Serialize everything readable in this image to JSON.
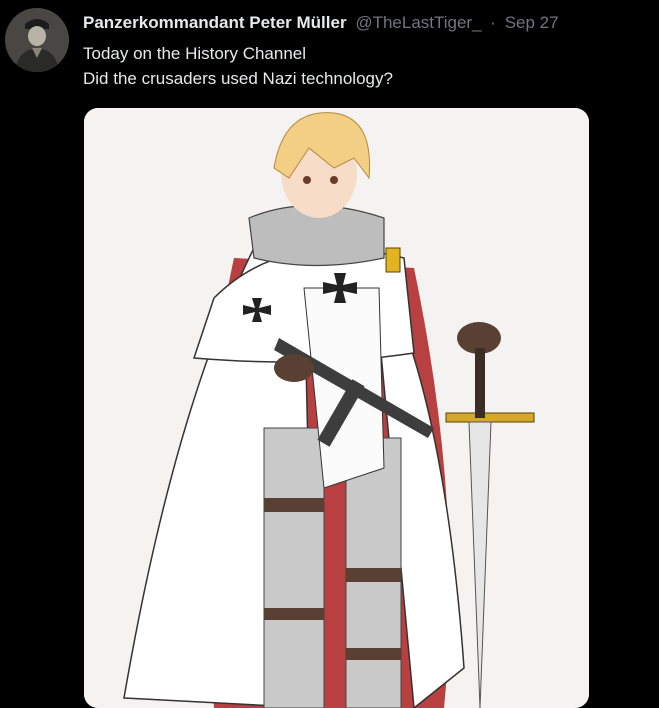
{
  "tweet": {
    "display_name": "Panzerkommandant Peter Müller",
    "handle": "@TheLastTiger_",
    "separator": "·",
    "date": "Sep 27",
    "text_lines": [
      "Today on the History Channel",
      "Did the crusaders used Nazi technology?"
    ],
    "avatar_icon": "profile-photo-soldier",
    "media_icon": "anime-crusader-knight-illustration"
  },
  "colors": {
    "background": "#000000",
    "text_primary": "#e7e9ea",
    "text_secondary": "#71767b",
    "media_background": "#f5f2f2"
  }
}
